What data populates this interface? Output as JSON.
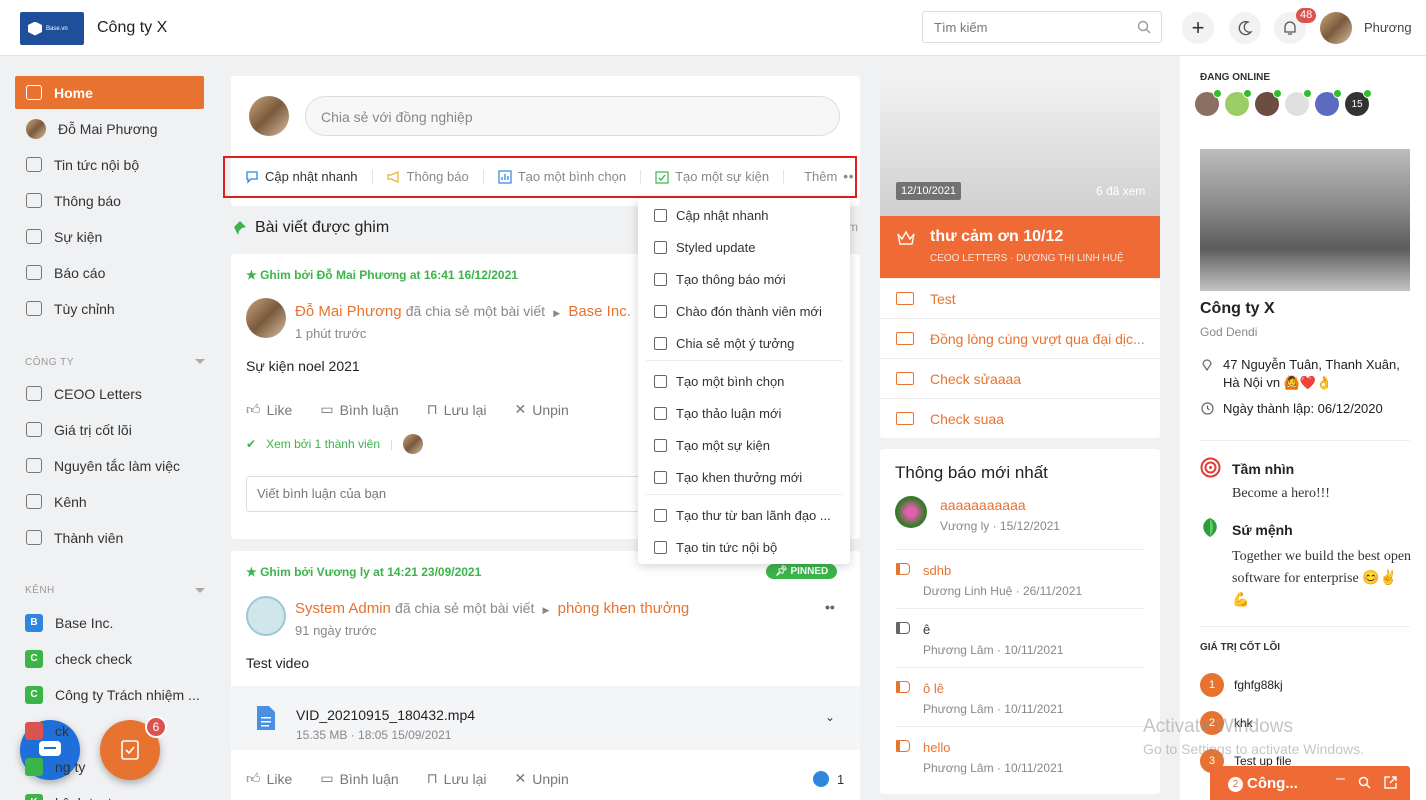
{
  "header": {
    "logo_text": "Base.vn",
    "company": "Công ty X",
    "search_placeholder": "Tìm kiếm",
    "notif_count": "48",
    "user_name": "Phương"
  },
  "sidebar": {
    "main": [
      {
        "label": "Home",
        "icon": "home-icon"
      },
      {
        "label": "Đỗ Mai Phương",
        "icon": "avatar"
      },
      {
        "label": "Tin tức nội bộ",
        "icon": "news-icon"
      },
      {
        "label": "Thông báo",
        "icon": "megaphone-icon"
      },
      {
        "label": "Sự kiện",
        "icon": "calendar-icon"
      },
      {
        "label": "Báo cáo",
        "icon": "chart-icon"
      },
      {
        "label": "Tùy chỉnh",
        "icon": "gear-icon"
      }
    ],
    "company_header": "CÔNG TY",
    "company_items": [
      {
        "label": "CEOO Letters"
      },
      {
        "label": "Giá trị cốt lõi"
      },
      {
        "label": "Nguyên tắc làm việc"
      },
      {
        "label": "Kênh"
      },
      {
        "label": "Thành viên"
      }
    ],
    "channel_header": "KÊNH",
    "channels": [
      {
        "letter": "B",
        "label": "Base Inc.",
        "color": "#2e86de"
      },
      {
        "letter": "C",
        "label": "check check",
        "color": "#3bb54a"
      },
      {
        "letter": "C",
        "label": "Công ty Trách nhiệm ...",
        "color": "#3bb54a"
      },
      {
        "letter": "",
        "label": "ck",
        "color": "#d9534f"
      },
      {
        "letter": "",
        "label": "ng ty",
        "color": "#3bb54a"
      },
      {
        "letter": "K",
        "label": "kênh test",
        "color": "#3bb54a"
      }
    ],
    "fab_badge": "6"
  },
  "composer": {
    "placeholder": "Chia sẻ với đồng nghiệp",
    "actions": [
      "Cập nhật nhanh",
      "Thông báo",
      "Tạo một bình chọn",
      "Tạo một sự kiện"
    ],
    "more": "Thêm"
  },
  "dropdown": [
    "Cập nhật nhanh",
    "Styled update",
    "Tạo thông báo mới",
    "Chào đón thành viên mới",
    "Chia sẻ một ý tưởng",
    "Tạo một bình chọn",
    "Tạo thảo luận mới",
    "Tạo một sự kiện",
    "Tạo khen thưởng mới",
    "Tạo thư từ ban lãnh đạo ...",
    "Tạo tin tức nội bộ"
  ],
  "pinned_title": "Bài viết được ghim",
  "post1": {
    "pin": "Ghim bởi Đỗ Mai Phương at 16:41 16/12/2021",
    "author": "Đỗ Mai Phương",
    "verb": "đã chia sẻ một bài viết",
    "target": "Base Inc.",
    "time": "1 phút trước",
    "body": "Sự kiện noel 2021",
    "seen": "Xem bởi 1 thành viên",
    "comment_placeholder": "Viết bình luận của bạn"
  },
  "post2": {
    "pin": "Ghim bởi Vương ly at 14:21 23/09/2021",
    "pinned_badge": "PINNED",
    "author": "System Admin",
    "verb": "đã chia sẻ một bài viết",
    "target": "phòng khen thưởng",
    "time": "91 ngày trước",
    "body": "Test video",
    "file_name": "VID_20210915_180432.mp4",
    "file_meta": "15.35 MB · 18:05 15/09/2021",
    "likes": "1"
  },
  "actions": {
    "like": "Like",
    "comment": "Bình luận",
    "save": "Lưu lại",
    "unpin": "Unpin"
  },
  "ceoo": {
    "date": "12/10/2021",
    "views": "6 đã xem",
    "title": "thư cảm ơn 10/12",
    "subtitle": "CEOO LETTERS · DƯƠNG THỊ LINH HUỆ",
    "letters": [
      "Test",
      "Đồng lòng cùng vượt qua đại dịc...",
      "Check sửaaaa",
      "Check suaa"
    ]
  },
  "notifications": {
    "title": "Thông báo mới nhất",
    "top": {
      "title": "aaaaaaaaaaa",
      "meta": "Vương ly · 15/12/2021"
    },
    "items": [
      {
        "title": "sdhb",
        "meta": "Dương Linh Huệ · 26/11/2021",
        "orange": true
      },
      {
        "title": "ê",
        "meta": "Phương Lâm · 10/11/2021",
        "orange": false
      },
      {
        "title": "ô lê",
        "meta": "Phương Lâm · 10/11/2021",
        "orange": true
      },
      {
        "title": "hello",
        "meta": "Phương Lâm · 10/11/2021",
        "orange": true
      }
    ]
  },
  "right": {
    "online_header": "ĐANG ONLINE",
    "online_more": "15",
    "company": "Công ty X",
    "tagline": "God Dendi",
    "address": "47 Nguyễn Tuân, Thanh Xuân, Hà Nội vn 🙆❤️👌",
    "founded": "Ngày thành lập: 06/12/2020",
    "vision_title": "Tầm nhìn",
    "vision": "Become a hero!!!",
    "mission_title": "Sứ mệnh",
    "mission": "Together we build the best open software for enterprise 😊✌️💪",
    "values_header": "GIÁ TRỊ CỐT LÕI",
    "values": [
      {
        "n": "1",
        "label": "fghfg88kj"
      },
      {
        "n": "2",
        "label": "khk"
      },
      {
        "n": "3",
        "label": "Test up file"
      }
    ]
  },
  "watermark": {
    "line1": "Activate Windows",
    "line2": "Go to Settings to activate Windows."
  },
  "chatbar": {
    "count": "2",
    "label": "Công..."
  }
}
